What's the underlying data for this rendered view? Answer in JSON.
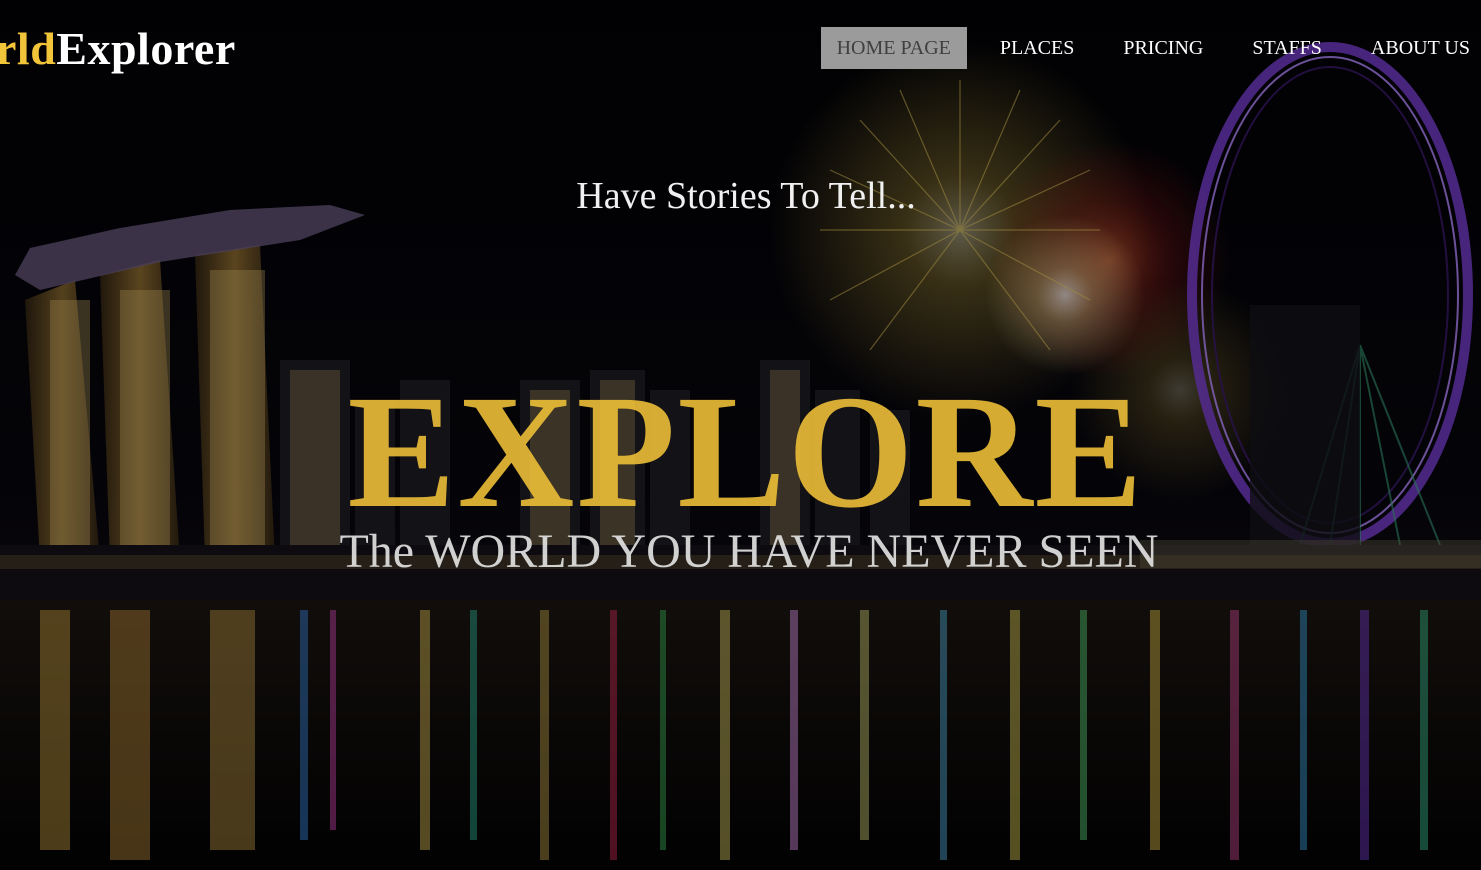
{
  "brand": {
    "prefix": "rld",
    "main": "Explorer",
    "accent_color": "#f2c43a"
  },
  "nav": {
    "items": [
      {
        "label": "HOME PAGE",
        "active": true
      },
      {
        "label": "PLACES",
        "active": false
      },
      {
        "label": "PRICING",
        "active": false
      },
      {
        "label": "STAFFS",
        "active": false
      },
      {
        "label": "ABOUT US",
        "active": false
      }
    ]
  },
  "hero": {
    "tagline": "Have Stories To Tell...",
    "headline": "EXPLORE",
    "subheadline": "The WORLD YOU HAVE NEVER SEEN",
    "headline_color": "#ecbe37"
  }
}
